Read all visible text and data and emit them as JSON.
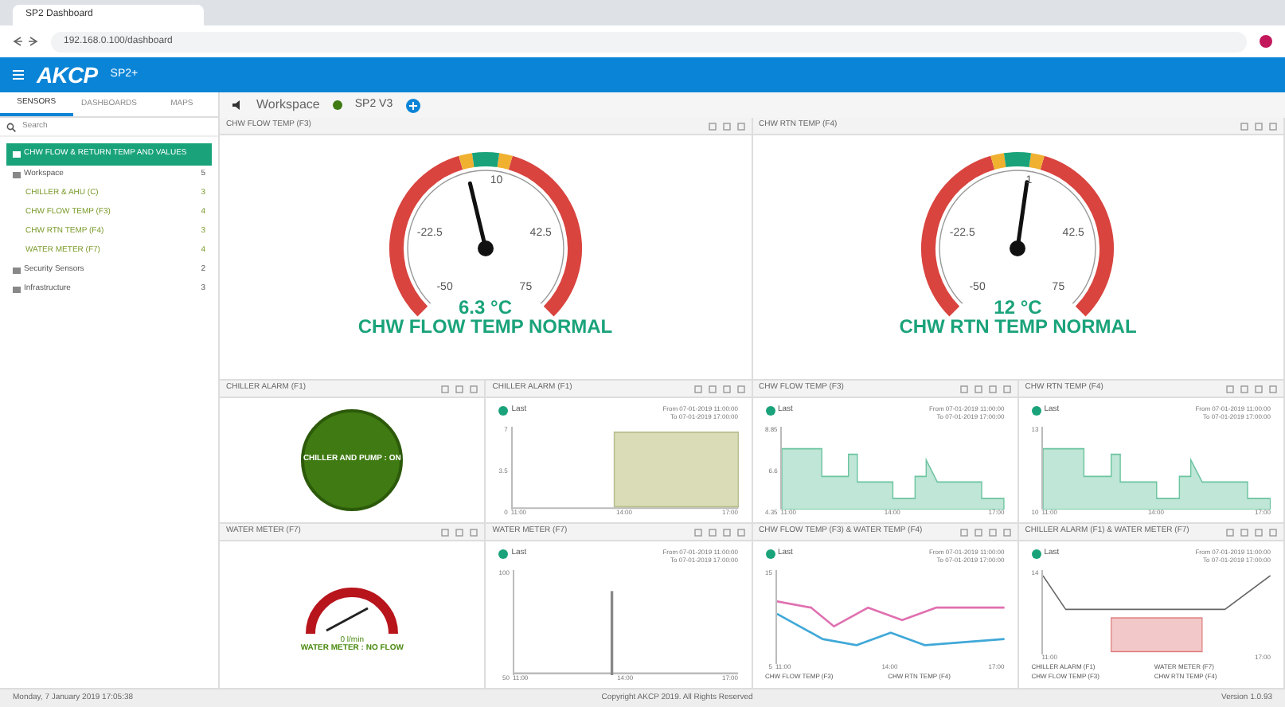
{
  "browser": {
    "tab_title": "SP2 Dashboard",
    "url": "192.168.0.100/dashboard"
  },
  "header": {
    "logo": "AKCP",
    "product": "SP2+"
  },
  "sidebar": {
    "tabs": [
      {
        "label": "SENSORS",
        "selected": true
      },
      {
        "label": "DASHBOARDS",
        "selected": false
      },
      {
        "label": "MAPS",
        "selected": false
      }
    ],
    "search": {
      "placeholder": "Search"
    },
    "items": [
      {
        "kind": "group",
        "label": "CHW FLOW & RETURN TEMP AND VALUES",
        "selected": true
      },
      {
        "kind": "group",
        "label": "Workspace",
        "count": "5",
        "selected": false
      },
      {
        "kind": "sensor",
        "label": "CHILLER & AHU (C)",
        "count": "3",
        "selected": false
      },
      {
        "kind": "sensor",
        "label": "CHW FLOW TEMP (F3)",
        "count": "4",
        "selected": false
      },
      {
        "kind": "sensor",
        "label": "CHW RTN TEMP (F4)",
        "count": "3",
        "selected": false
      },
      {
        "kind": "sensor",
        "label": "WATER METER (F7)",
        "count": "4",
        "selected": false
      },
      {
        "kind": "group",
        "label": "Security Sensors",
        "count": "2",
        "selected": false
      },
      {
        "kind": "group",
        "label": "Infrastructure",
        "count": "3",
        "selected": false
      }
    ]
  },
  "toolbar": {
    "workspace": "Workspace",
    "device": "SP2 V3"
  },
  "gauges": [
    {
      "title": "CHW FLOW TEMP (F3)",
      "ticks": [
        "-50",
        "-22.5",
        "10",
        "42.5",
        "75"
      ],
      "value": "6.3 °C",
      "status": "CHW FLOW TEMP NORMAL"
    },
    {
      "title": "CHW RTN TEMP (F4)",
      "ticks": [
        "-50",
        "-22.5",
        "1",
        "42.5",
        "75"
      ],
      "value": "12 °C",
      "status": "CHW RTN TEMP NORMAL"
    }
  ],
  "widgets": [
    {
      "kind": "status",
      "title": "CHILLER ALARM (F1)",
      "text": "CHILLER AND PUMP : ON"
    },
    {
      "kind": "blocks",
      "title": "CHILLER ALARM (F1)",
      "legend": "Last",
      "range": [
        "From 07-01-2019 11:00:00",
        "To 07-01-2019 17:00:00"
      ],
      "yticks": [
        "7",
        "3.5",
        "0"
      ],
      "xticks": [
        "11:00",
        "14:00",
        "17:00"
      ]
    },
    {
      "kind": "area",
      "title": "CHW FLOW TEMP (F3)",
      "legend": "Last",
      "range": [
        "From 07-01-2019 11:00:00",
        "To 07-01-2019 17:00:00"
      ],
      "yticks": [
        "8.85",
        "6.6",
        "4.35"
      ],
      "xticks": [
        "11:00",
        "14:00",
        "17:00"
      ]
    },
    {
      "kind": "area",
      "title": "CHW RTN TEMP (F4)",
      "legend": "Last",
      "range": [
        "From 07-01-2019 11:00:00",
        "To 07-01-2019 17:00:00"
      ],
      "yticks": [
        "13",
        "10"
      ],
      "xticks": [
        "11:00",
        "14:00",
        "17:00"
      ]
    },
    {
      "kind": "meter",
      "title": "WATER METER (F7)",
      "value": "0 l/min",
      "text": "WATER METER : NO FLOW"
    },
    {
      "kind": "spike",
      "title": "WATER METER (F7)",
      "legend": "Last",
      "range": [
        "From 07-01-2019 11:00:00",
        "To 07-01-2019 17:00:00"
      ],
      "yticks": [
        "100",
        "50"
      ],
      "xticks": [
        "11:00",
        "14:00",
        "17:00"
      ]
    },
    {
      "kind": "lines",
      "title": "CHW FLOW TEMP (F3) & WATER TEMP (F4)",
      "legend": "Last",
      "range": [
        "From 07-01-2019 11:00:00",
        "To 07-01-2019 17:00:00"
      ],
      "yticks": [
        "15",
        "5"
      ],
      "xticks": [
        "11:00",
        "14:00",
        "17:00"
      ],
      "series": [
        "CHW FLOW TEMP (F3)",
        "CHW RTN TEMP (F4)"
      ]
    },
    {
      "kind": "dots",
      "title": "CHILLER ALARM (F1) & WATER METER (F7)",
      "legend": "Last",
      "range": [
        "From 07-01-2019 11:00:00",
        "To 07-01-2019 17:00:00"
      ],
      "yticks": [
        "14"
      ],
      "xticks": [
        "11:00",
        "17:00"
      ],
      "series": [
        "CHILLER ALARM (F1)",
        "WATER METER (F7)",
        "CHW FLOW TEMP (F3)",
        "CHW RTN TEMP (F4)"
      ]
    }
  ],
  "footer": {
    "left": "Monday, 7 January 2019 17:05:38",
    "center": "Copyright AKCP 2019. All Rights Reserved",
    "right": "Version 1.0.93"
  }
}
